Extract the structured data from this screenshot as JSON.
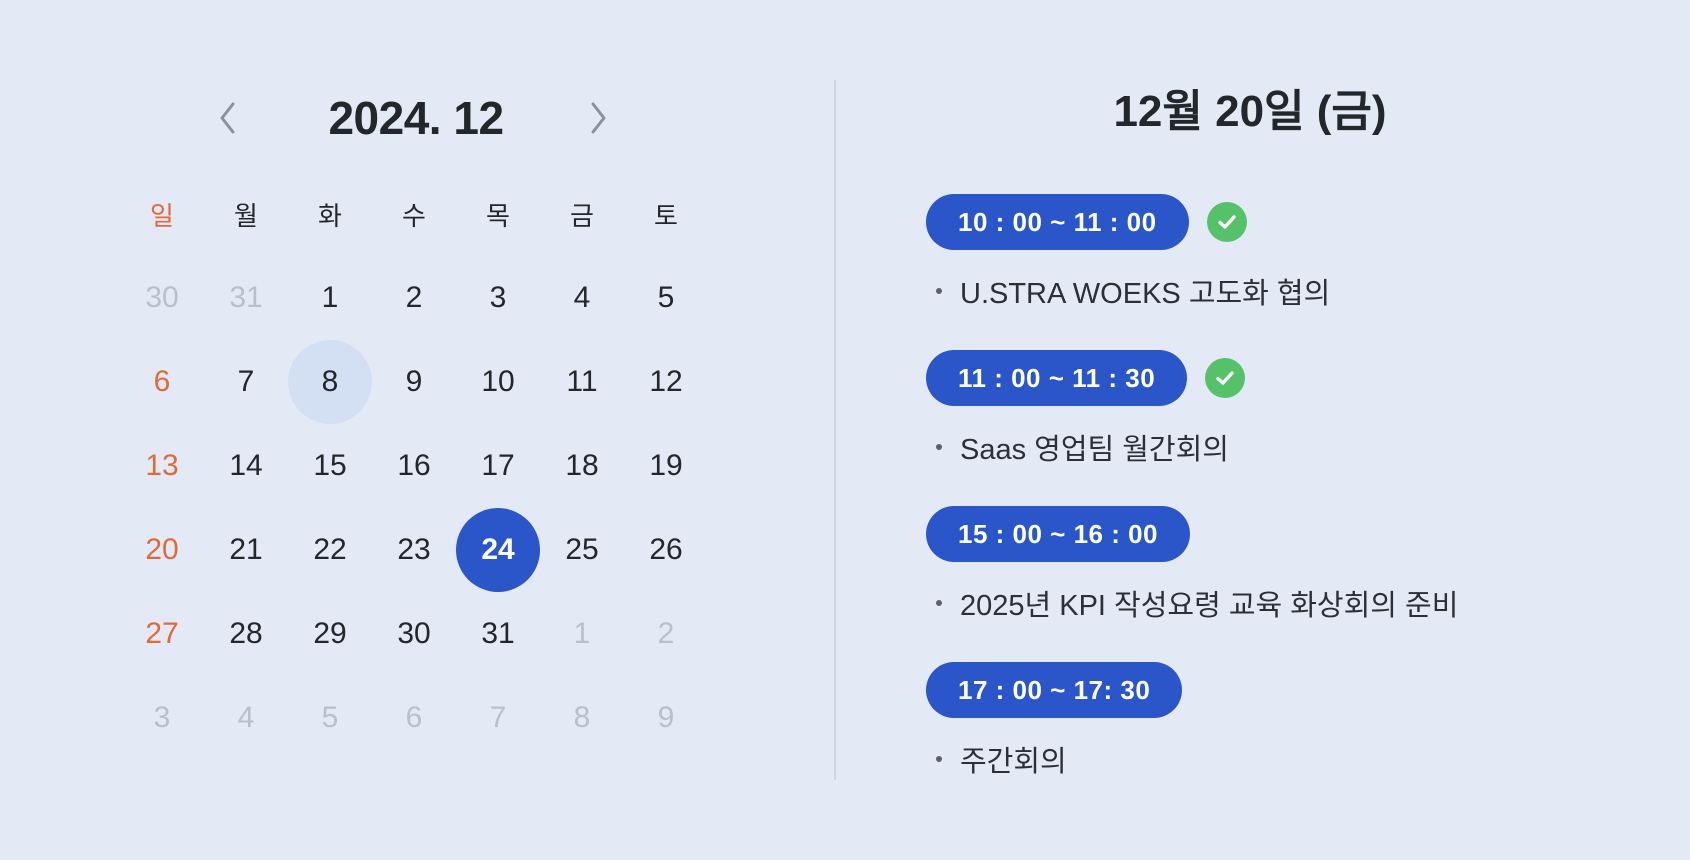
{
  "calendar": {
    "month_title": "2024. 12",
    "weekdays": [
      "일",
      "월",
      "화",
      "수",
      "목",
      "금",
      "토"
    ],
    "weeks": [
      [
        {
          "d": "30",
          "m": true
        },
        {
          "d": "31",
          "m": true
        },
        {
          "d": "1"
        },
        {
          "d": "2"
        },
        {
          "d": "3"
        },
        {
          "d": "4"
        },
        {
          "d": "5"
        }
      ],
      [
        {
          "d": "6"
        },
        {
          "d": "7"
        },
        {
          "d": "8",
          "hl": true
        },
        {
          "d": "9"
        },
        {
          "d": "10"
        },
        {
          "d": "11"
        },
        {
          "d": "12"
        }
      ],
      [
        {
          "d": "13"
        },
        {
          "d": "14"
        },
        {
          "d": "15"
        },
        {
          "d": "16"
        },
        {
          "d": "17"
        },
        {
          "d": "18"
        },
        {
          "d": "19"
        }
      ],
      [
        {
          "d": "20"
        },
        {
          "d": "21"
        },
        {
          "d": "22"
        },
        {
          "d": "23"
        },
        {
          "d": "24",
          "sel": true
        },
        {
          "d": "25"
        },
        {
          "d": "26"
        }
      ],
      [
        {
          "d": "27"
        },
        {
          "d": "28"
        },
        {
          "d": "29"
        },
        {
          "d": "30"
        },
        {
          "d": "31"
        },
        {
          "d": "1",
          "m": true
        },
        {
          "d": "2",
          "m": true
        }
      ],
      [
        {
          "d": "3",
          "m": true
        },
        {
          "d": "4",
          "m": true
        },
        {
          "d": "5",
          "m": true
        },
        {
          "d": "6",
          "m": true
        },
        {
          "d": "7",
          "m": true
        },
        {
          "d": "8",
          "m": true
        },
        {
          "d": "9",
          "m": true
        }
      ]
    ],
    "prev_icon": "chevron-left-icon",
    "next_icon": "chevron-right-icon"
  },
  "schedule": {
    "day_title": "12월 20일 (금)",
    "events": [
      {
        "time": "10 : 00 ~ 11 : 00",
        "title": "U.STRA WOEKS 고도화 협의",
        "done": true
      },
      {
        "time": "11 : 00 ~ 11 : 30",
        "title": "Saas 영업팀 월간회의",
        "done": true
      },
      {
        "time": "15 : 00 ~ 16 : 00",
        "title": "2025년 KPI 작성요령 교육 화상회의 준비",
        "done": false
      },
      {
        "time": "17 : 00 ~ 17: 30",
        "title": "주간회의",
        "done": false
      }
    ]
  },
  "colors": {
    "background": "#e4eaf5",
    "accent": "#2b56c9",
    "sunday": "#e06a3a",
    "muted": "#b9c0cc",
    "highlight": "#d3dff3",
    "check": "#55c26a"
  }
}
